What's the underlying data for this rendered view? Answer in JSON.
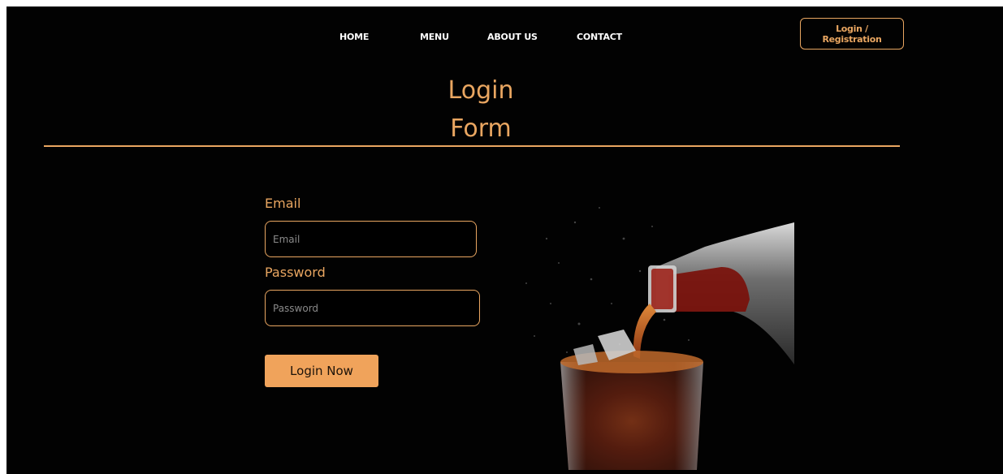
{
  "nav": {
    "items": [
      {
        "label": "HOME"
      },
      {
        "label": "MENU"
      },
      {
        "label": "ABOUT US"
      },
      {
        "label": "CONTACT"
      }
    ],
    "login_registration": "Login / Registration"
  },
  "title": {
    "line1": "Login",
    "line2": "Form"
  },
  "form": {
    "email_label": "Email",
    "email_placeholder": "Email",
    "email_value": "",
    "password_label": "Password",
    "password_placeholder": "Password",
    "password_value": "",
    "submit_label": "Login Now"
  },
  "image": {
    "subject": "cola-pour-photo"
  },
  "colors": {
    "background": "#020202",
    "accent": "#e9a661",
    "button": "#f0a35b",
    "nav_text": "#ffffff"
  }
}
